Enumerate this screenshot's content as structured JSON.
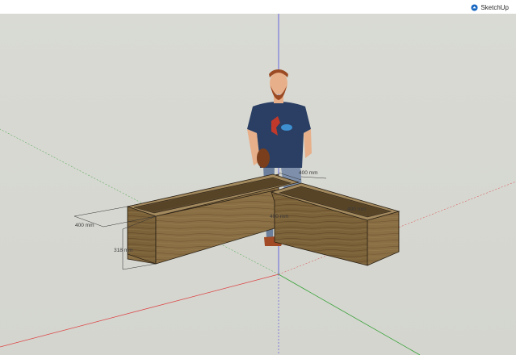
{
  "app": {
    "brand_label": "SketchUp",
    "icon": "sketchup-logo-icon"
  },
  "model": {
    "dimensions": {
      "width_left": "400 mm",
      "height_left": "318 mm",
      "width_right": "400 mm",
      "inner_mid": "400 mm",
      "inner_right": "400 mm"
    }
  },
  "colors": {
    "sky": "#d9dad4",
    "wood_light": "#8d7348",
    "wood_dark": "#6b5330",
    "axis_red": "#d33",
    "axis_green": "#3a3",
    "axis_blue": "#44d"
  }
}
